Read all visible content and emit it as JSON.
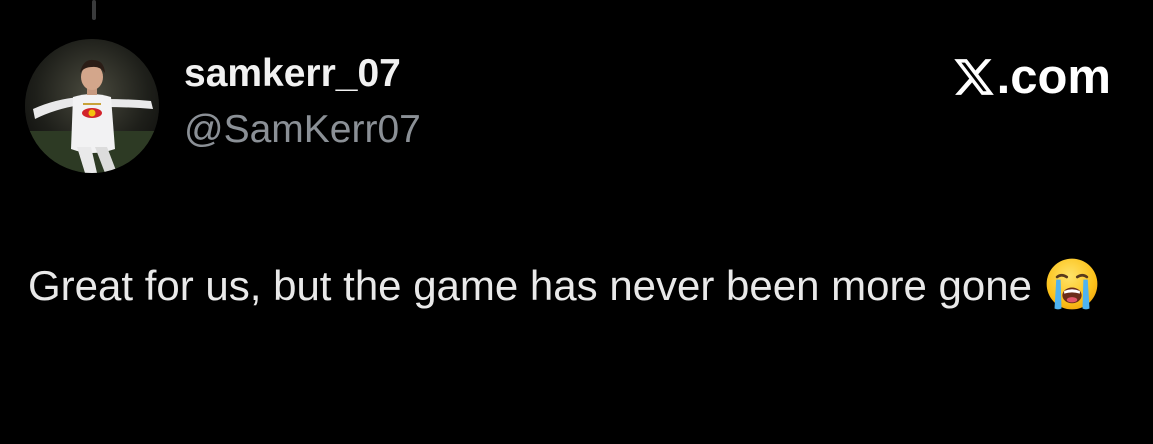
{
  "thread": {
    "line_color": "#3a3b3c"
  },
  "author": {
    "display_name": "samkerr_07",
    "handle": "@SamKerr07",
    "avatar": "avatar-photo"
  },
  "brand": {
    "icon": "x-logo-icon",
    "text": ".com"
  },
  "tweet": {
    "text": "Great for us, but the game has never been more gone",
    "emoji": "loudly-crying-face-icon"
  },
  "colors": {
    "background": "#000000",
    "primary_text": "#e7e9ea",
    "secondary_text": "#8b9096"
  }
}
